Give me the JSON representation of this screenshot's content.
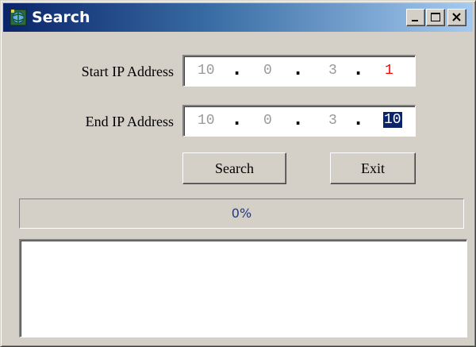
{
  "window": {
    "title": "Search",
    "icon": "app-globe-icon"
  },
  "titlebar_buttons": {
    "minimize": "minimize-icon",
    "maximize": "maximize-icon",
    "close": "close-icon"
  },
  "start_ip": {
    "label": "Start IP Address",
    "octets": [
      "10",
      "0",
      "3",
      "1"
    ],
    "separator": "."
  },
  "end_ip": {
    "label": "End IP Address",
    "octets": [
      "10",
      "0",
      "3",
      "10"
    ],
    "separator": "."
  },
  "buttons": {
    "search": "Search",
    "exit": "Exit"
  },
  "progress": {
    "value": 0,
    "text": "0%"
  },
  "results": {
    "items": []
  },
  "colors": {
    "title_gradient_start": "#0a246a",
    "title_gradient_end": "#a6caf0",
    "window_bg": "#d4d0c8",
    "highlight_octet": "#ff0000",
    "selection_bg": "#0a246a"
  }
}
